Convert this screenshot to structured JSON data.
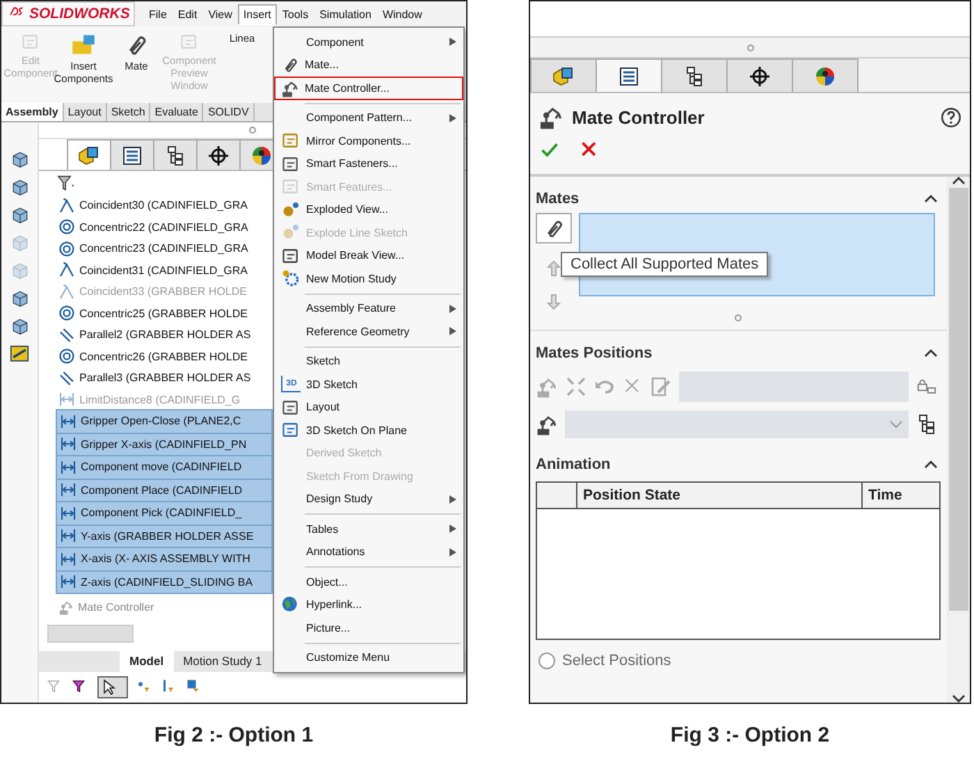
{
  "fig_left": {
    "logo": "SOLIDWORKS",
    "menu_bar": [
      {
        "label": "File",
        "selected": false
      },
      {
        "label": "Edit",
        "selected": false
      },
      {
        "label": "View",
        "selected": false
      },
      {
        "label": "Insert",
        "selected": true
      },
      {
        "label": "Tools",
        "selected": false
      },
      {
        "label": "Simulation",
        "selected": false
      },
      {
        "label": "Window",
        "selected": false
      }
    ],
    "toolbar": [
      {
        "label": "Edit Component",
        "disabled": true
      },
      {
        "label": "Insert Components",
        "disabled": false
      },
      {
        "label": "Mate",
        "disabled": false
      },
      {
        "label": "Component Preview Window",
        "disabled": true
      },
      {
        "label": "Linea",
        "disabled": false
      }
    ],
    "tabs": [
      {
        "label": "Assembly",
        "selected": true
      },
      {
        "label": "Layout",
        "selected": false
      },
      {
        "label": "Sketch",
        "selected": false
      },
      {
        "label": "Evaluate",
        "selected": false
      },
      {
        "label": "SOLIDV",
        "selected": false
      }
    ],
    "fm_tabs": [
      {
        "selected": true
      },
      {
        "selected": false
      },
      {
        "selected": false
      },
      {
        "selected": false
      },
      {
        "selected": false
      }
    ],
    "tree": [
      {
        "label": "Coincident30 (CADINFIELD_GRA",
        "kind": "coincident",
        "disabled": false,
        "selected": false
      },
      {
        "label": "Concentric22 (CADINFIELD_GRA",
        "kind": "concentric",
        "disabled": false,
        "selected": false
      },
      {
        "label": "Concentric23 (CADINFIELD_GRA",
        "kind": "concentric",
        "disabled": false,
        "selected": false
      },
      {
        "label": "Coincident31 (CADINFIELD_GRA",
        "kind": "coincident",
        "disabled": false,
        "selected": false
      },
      {
        "label": "Coincident33 (GRABBER HOLDE",
        "kind": "coincident",
        "disabled": true,
        "selected": false
      },
      {
        "label": "Concentric25 (GRABBER HOLDE",
        "kind": "concentric",
        "disabled": false,
        "selected": false
      },
      {
        "label": "Parallel2 (GRABBER HOLDER AS",
        "kind": "parallel",
        "disabled": false,
        "selected": false
      },
      {
        "label": "Concentric26 (GRABBER HOLDE",
        "kind": "concentric",
        "disabled": false,
        "selected": false
      },
      {
        "label": "Parallel3 (GRABBER HOLDER AS",
        "kind": "parallel",
        "disabled": false,
        "selected": false
      },
      {
        "label": "LimitDistance8 (CADINFIELD_G",
        "kind": "limit",
        "disabled": true,
        "selected": false
      },
      {
        "label": "Gripper Open-Close (PLANE2,C",
        "kind": "limit",
        "disabled": false,
        "selected": true
      },
      {
        "label": "Gripper X-axis (CADINFIELD_PN",
        "kind": "limit",
        "disabled": false,
        "selected": true
      },
      {
        "label": "Component move (CADINFIELD",
        "kind": "limit",
        "disabled": false,
        "selected": true
      },
      {
        "label": "Component Place (CADINFIELD",
        "kind": "limit",
        "disabled": false,
        "selected": true
      },
      {
        "label": "Component Pick (CADINFIELD_",
        "kind": "limit",
        "disabled": false,
        "selected": true
      },
      {
        "label": "Y-axis (GRABBER HOLDER ASSE",
        "kind": "limit",
        "disabled": false,
        "selected": true
      },
      {
        "label": "X-axis (X- AXIS ASSEMBLY WITH",
        "kind": "limit",
        "disabled": false,
        "selected": true
      },
      {
        "label": "Z-axis (CADINFIELD_SLIDING BA",
        "kind": "limit",
        "disabled": false,
        "selected": true
      }
    ],
    "tree_footer": "Mate Controller",
    "bottom_tabs": [
      {
        "label": "Model",
        "selected": true
      },
      {
        "label": "Motion Study 1",
        "selected": false
      }
    ],
    "insert_menu": [
      {
        "kind": "submenu",
        "label": "Component",
        "disabled": false
      },
      {
        "kind": "item",
        "label": "Mate...",
        "disabled": false
      },
      {
        "kind": "item",
        "label": "Mate Controller...",
        "disabled": false,
        "highlighted": true
      },
      {
        "kind": "separator"
      },
      {
        "kind": "submenu",
        "label": "Component Pattern...",
        "disabled": false
      },
      {
        "kind": "item",
        "label": "Mirror Components...",
        "disabled": false
      },
      {
        "kind": "item",
        "label": "Smart Fasteners...",
        "disabled": false
      },
      {
        "kind": "item",
        "label": "Smart Features...",
        "disabled": true
      },
      {
        "kind": "item",
        "label": "Exploded View...",
        "disabled": false
      },
      {
        "kind": "item",
        "label": "Explode Line Sketch",
        "disabled": true
      },
      {
        "kind": "item",
        "label": "Model Break View...",
        "disabled": false
      },
      {
        "kind": "item",
        "label": "New Motion Study",
        "disabled": false
      },
      {
        "kind": "separator"
      },
      {
        "kind": "submenu",
        "label": "Assembly Feature",
        "disabled": false
      },
      {
        "kind": "submenu",
        "label": "Reference Geometry",
        "disabled": false
      },
      {
        "kind": "separator"
      },
      {
        "kind": "item",
        "label": "Sketch",
        "disabled": false
      },
      {
        "kind": "item",
        "label": "3D Sketch",
        "disabled": false,
        "icon_label": "3D"
      },
      {
        "kind": "item",
        "label": "Layout",
        "disabled": false
      },
      {
        "kind": "item",
        "label": "3D Sketch On Plane",
        "disabled": false
      },
      {
        "kind": "item",
        "label": "Derived Sketch",
        "disabled": true
      },
      {
        "kind": "item",
        "label": "Sketch From Drawing",
        "disabled": true
      },
      {
        "kind": "submenu",
        "label": "Design Study",
        "disabled": false
      },
      {
        "kind": "separator"
      },
      {
        "kind": "submenu",
        "label": "Tables",
        "disabled": false
      },
      {
        "kind": "submenu",
        "label": "Annotations",
        "disabled": false
      },
      {
        "kind": "separator"
      },
      {
        "kind": "item",
        "label": "Object...",
        "disabled": false
      },
      {
        "kind": "item",
        "label": "Hyperlink...",
        "disabled": false
      },
      {
        "kind": "item",
        "label": "Picture...",
        "disabled": false
      },
      {
        "kind": "separator"
      },
      {
        "kind": "item",
        "label": "Customize Menu",
        "disabled": false
      }
    ],
    "caption": "Fig 2 :- Option 1"
  },
  "fig_right": {
    "tabs": [
      {
        "selected": false
      },
      {
        "selected": true
      },
      {
        "selected": false
      },
      {
        "selected": false
      },
      {
        "selected": false
      }
    ],
    "title": "Mate Controller",
    "mates_title": "Mates",
    "tooltip": "Collect All Supported Mates",
    "positions_title": "Mates Positions",
    "animation_title": "Animation",
    "table_columns": [
      "Position State",
      "Time"
    ],
    "select_positions": {
      "label": "Select Positions",
      "checked": false
    },
    "caption": "Fig 3 :- Option 2"
  }
}
